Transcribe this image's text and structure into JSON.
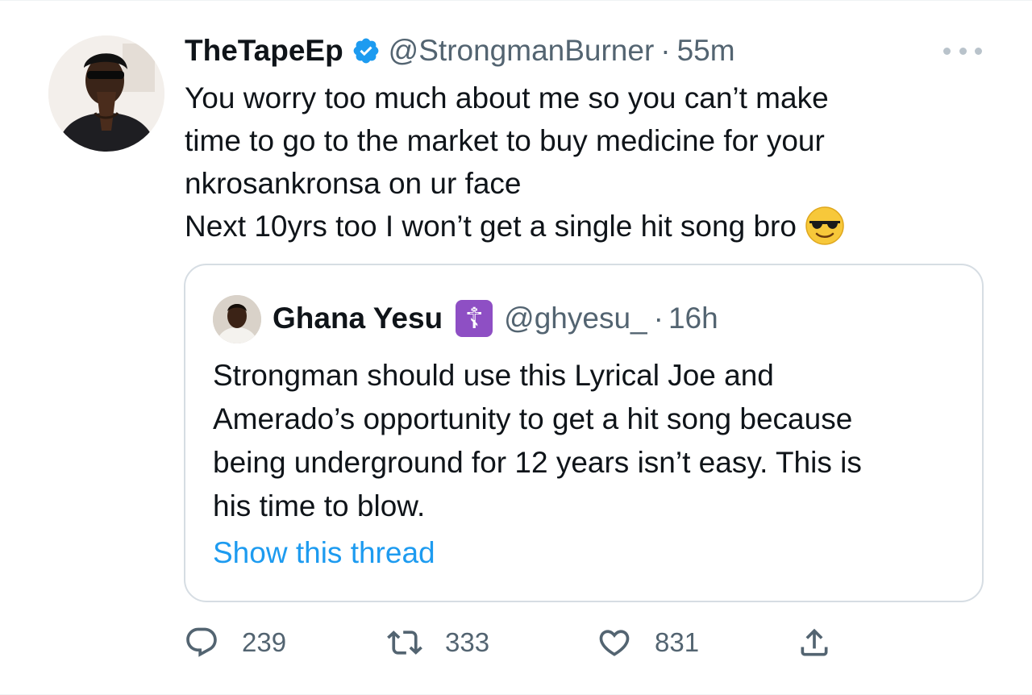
{
  "author": {
    "display_name": "TheTapeEp",
    "handle": "@StrongmanBurner",
    "separator": "·",
    "time": "55m",
    "avatar_icon": "profile-photo"
  },
  "tweet": {
    "lines": [
      "You worry too much about me so you can’t make",
      "time to go to the market to buy medicine for your",
      "nkrosankronsa on ur face",
      "Next 10yrs too I won’t get a single hit song bro"
    ],
    "emoji": "smiling-face-with-sunglasses"
  },
  "quoted": {
    "display_name": "Ghana Yesu",
    "badge": "☦",
    "handle": "@ghyesu_",
    "separator": "·",
    "time": "16h",
    "lines": [
      "Strongman should use this Lyrical Joe and",
      "Amerado’s opportunity to get a hit song because",
      "being underground for 12 years isn’t easy. This is",
      "his time to blow."
    ],
    "thread_link": "Show this thread"
  },
  "actions": {
    "replies": "239",
    "retweets": "333",
    "likes": "831"
  },
  "colors": {
    "text": "#0f1419",
    "muted": "#536471",
    "link": "#1d9bf0",
    "verified": "#1d9bf0",
    "badge": "#8e4fc4",
    "border": "#d6dde3"
  }
}
